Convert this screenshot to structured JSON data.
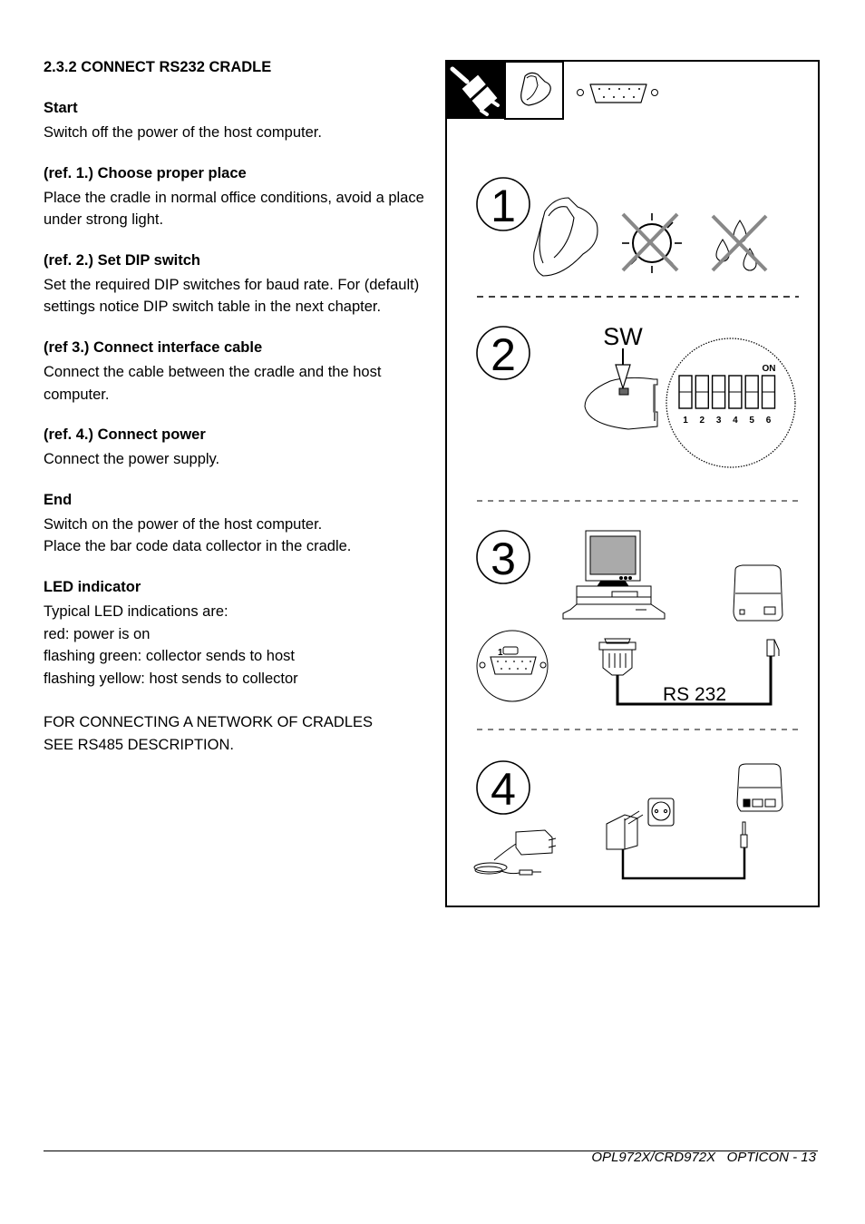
{
  "section_title": "2.3.2 CONNECT RS232 CRADLE",
  "sections": [
    {
      "heading": "Start",
      "lines": [
        "Switch off the power of the host computer."
      ]
    },
    {
      "heading": "(ref. 1.) Choose proper place",
      "lines": [
        "Place the cradle in normal office conditions, avoid a place under strong light."
      ]
    },
    {
      "heading": "(ref. 2.) Set DIP switch",
      "lines": [
        "Set the required DIP switches for baud rate. For (default) settings notice DIP switch table in the next chapter."
      ]
    },
    {
      "heading": "(ref 3.) Connect interface cable",
      "lines": [
        "Connect the cable between the cradle and the host computer."
      ]
    },
    {
      "heading": "(ref. 4.) Connect power",
      "lines": [
        "Connect the power supply."
      ]
    },
    {
      "heading": "End",
      "lines": [
        "Switch on the power of the host computer.",
        "Place the bar code data collector in the cradle."
      ]
    },
    {
      "heading": "LED indicator",
      "lines": [
        "Typical LED indications are:",
        "red: power is on",
        "flashing green: collector sends to host",
        "flashing yellow: host sends to collector"
      ]
    }
  ],
  "note_lines": [
    "FOR CONNECTING A NETWORK OF CRADLES",
    "SEE RS485 DESCRIPTION."
  ],
  "figure": {
    "header_icons": [
      "power-plug-icon",
      "cradle-icon",
      "db9-connector-icon"
    ],
    "steps": [
      {
        "number": "1",
        "icons": [
          "cradle-icon",
          "no-sunlight-icon",
          "no-moisture-icon"
        ]
      },
      {
        "number": "2",
        "switch_label": "SW",
        "dip_on_label": "ON",
        "dip_numbers": [
          "1",
          "2",
          "3",
          "4",
          "5",
          "6"
        ]
      },
      {
        "number": "3",
        "port_label": "1",
        "cable_label": "RS 232"
      },
      {
        "number": "4",
        "icons": [
          "power-adapter-icon",
          "wall-socket-icon",
          "cradle-back-icon"
        ]
      }
    ]
  },
  "footer": {
    "text": "OPL972X/CRD972X   OPTICON - 13"
  }
}
